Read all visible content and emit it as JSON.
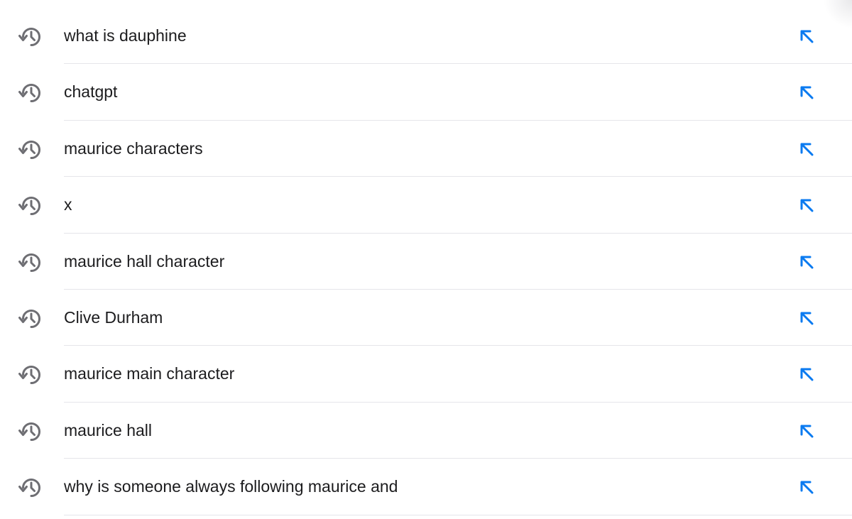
{
  "history": {
    "items": [
      {
        "query": "what is dauphine"
      },
      {
        "query": "chatgpt"
      },
      {
        "query": "maurice characters"
      },
      {
        "query": "x"
      },
      {
        "query": "maurice hall character"
      },
      {
        "query": "Clive Durham"
      },
      {
        "query": "maurice main character"
      },
      {
        "query": "maurice hall"
      },
      {
        "query": "why is someone always following maurice and"
      }
    ]
  },
  "icons": {
    "history": "clock-arrow-circlepath-icon",
    "fill_query": "arrow-up-left-icon"
  },
  "colors": {
    "accent": "#0a7af0",
    "icon_gray": "#6e6e73",
    "text": "#1c1c1e",
    "separator": "#e5e5ea"
  }
}
